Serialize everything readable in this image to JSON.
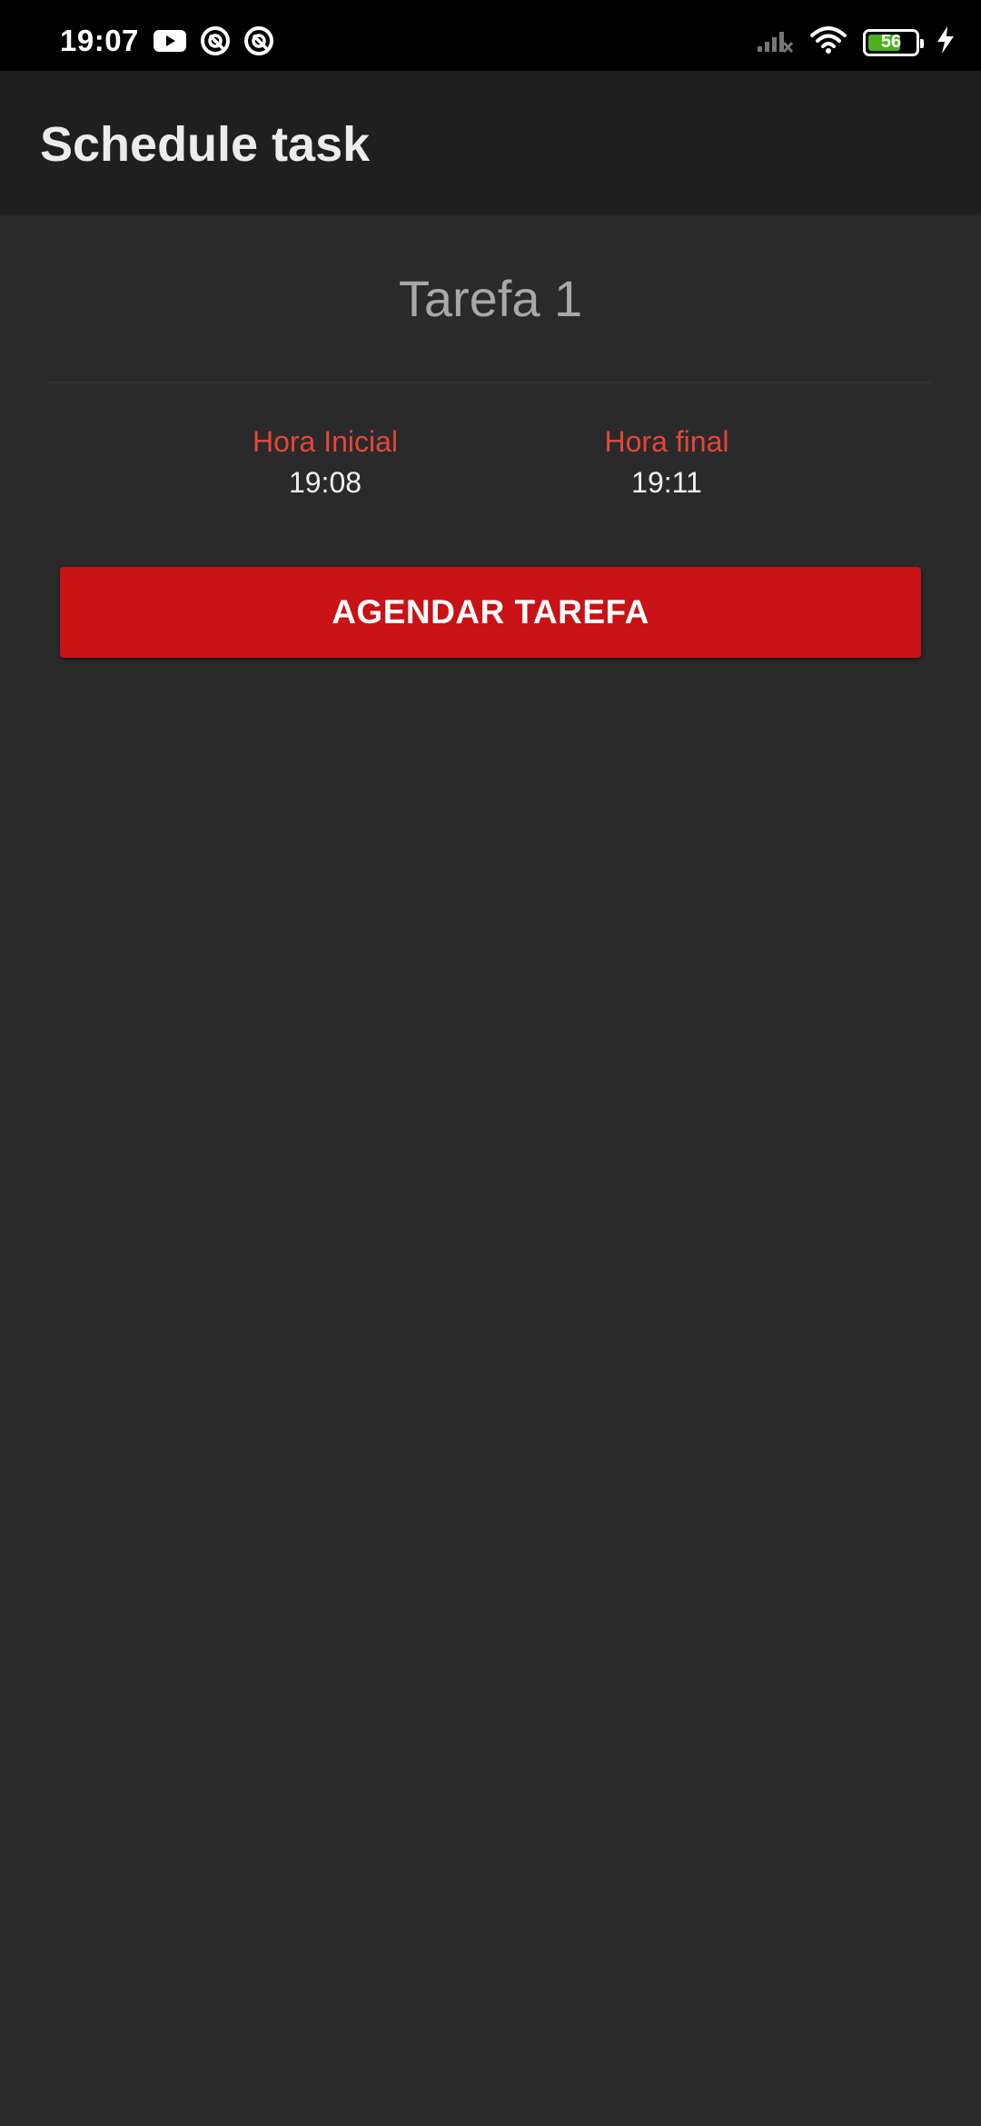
{
  "status_bar": {
    "time": "19:07",
    "left_icons": [
      "youtube-icon",
      "notification-icon",
      "notification-icon"
    ],
    "right_icons": [
      "signal-icon",
      "wifi-icon",
      "battery-icon",
      "charging-icon"
    ],
    "battery_level": "56",
    "battery_color": "#4caf1d"
  },
  "app_bar": {
    "title": "Schedule task"
  },
  "task": {
    "title": "Tarefa 1",
    "start_label": "Hora Inicial",
    "start_time": "19:08",
    "end_label": "Hora final",
    "end_time": "19:11"
  },
  "actions": {
    "schedule_label": "AGENDAR TAREFA"
  },
  "colors": {
    "accent": "#c81215",
    "label": "#e2473a",
    "background": "#2a2a2a",
    "app_bar": "#1f1f1f"
  }
}
